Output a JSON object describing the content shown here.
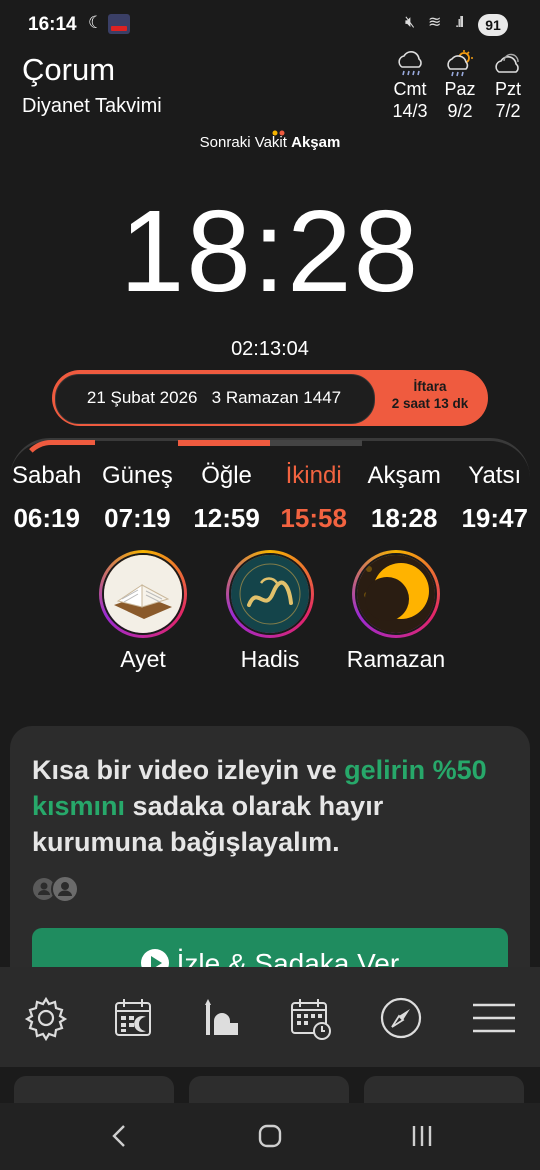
{
  "status_bar": {
    "time": "16:14",
    "battery": "91"
  },
  "header": {
    "city": "Çorum",
    "subtitle": "Diyanet Takvimi"
  },
  "weather": [
    {
      "day": "Cmt",
      "temp": "14/3",
      "icon": "rain-cloud-icon"
    },
    {
      "day": "Paz",
      "temp": "9/2",
      "icon": "sun-rain-cloud-icon"
    },
    {
      "day": "Pzt",
      "temp": "7/2",
      "icon": "cloud-icon"
    }
  ],
  "next_prayer": {
    "prefix": "Sonraki Vakit",
    "name": "Akşam",
    "time": "18:28",
    "countdown": "02:13:04"
  },
  "date_bar": {
    "date": "21 Şubat 2026   3 Ramazan 1447",
    "iftar_label": "İftara",
    "iftar_remaining": "2 saat 13 dk"
  },
  "prayers": [
    {
      "name": "Sabah",
      "time": "06:19",
      "active": false
    },
    {
      "name": "Güneş",
      "time": "07:19",
      "active": false
    },
    {
      "name": "Öğle",
      "time": "12:59",
      "active": false
    },
    {
      "name": "İkindi",
      "time": "15:58",
      "active": true
    },
    {
      "name": "Akşam",
      "time": "18:28",
      "active": false
    },
    {
      "name": "Yatsı",
      "time": "19:47",
      "active": false
    }
  ],
  "stories": [
    {
      "label": "Ayet",
      "icon": "quran-book-icon"
    },
    {
      "label": "Hadis",
      "icon": "muhammad-calligraphy-icon"
    },
    {
      "label": "Ramazan",
      "icon": "crescent-moon-icon"
    }
  ],
  "promo": {
    "text_a": "Kısa bir video izleyin ve ",
    "text_highlight": "gelirin %50 kısmını",
    "text_b": " sadaka olarak hayır kurumuna bağışlayalım.",
    "button_label": "İzle & Sadaka Ver"
  },
  "bottom_nav": [
    "settings-gear-icon",
    "calendar-moon-icon",
    "mosque-icon",
    "calendar-clock-icon",
    "compass-icon",
    "menu-icon"
  ],
  "colors": {
    "accent": "#ef5b3f",
    "green": "#1f8c5f",
    "highlight_green": "#27a86a",
    "background": "#1b1b1b"
  }
}
